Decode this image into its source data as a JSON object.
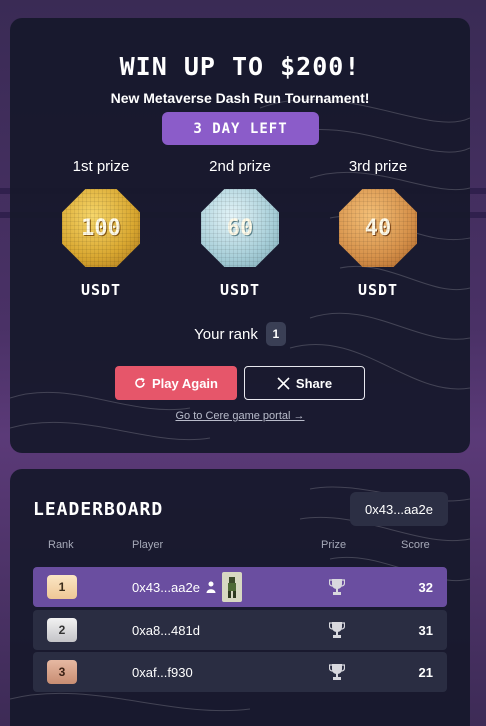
{
  "tournament": {
    "headline": "WIN UP TO $200!",
    "subtitle": "New Metaverse Dash Run Tournament!",
    "days_left": "3 DAY LEFT",
    "prizes": [
      {
        "label": "1st prize",
        "amount": "100",
        "currency": "USDT",
        "tier": "gold"
      },
      {
        "label": "2nd prize",
        "amount": "60",
        "currency": "USDT",
        "tier": "silver"
      },
      {
        "label": "3rd prize",
        "amount": "40",
        "currency": "USDT",
        "tier": "bronze"
      }
    ],
    "rank_label": "Your rank",
    "rank_value": "1",
    "play_again_label": "Play Again",
    "share_label": "Share",
    "portal_link": "Go to Cere game portal →"
  },
  "leaderboard": {
    "title": "LEADERBOARD",
    "wallet": "0x43...aa2e",
    "columns": {
      "rank": "Rank",
      "player": "Player",
      "prize": "Prize",
      "score": "Score"
    },
    "rows": [
      {
        "rank": "1",
        "player": "0x43...aa2e",
        "score": "32",
        "is_me": true
      },
      {
        "rank": "2",
        "player": "0xa8...481d",
        "score": "31",
        "is_me": false
      },
      {
        "rank": "3",
        "player": "0xaf...f930",
        "score": "21",
        "is_me": false
      }
    ]
  },
  "colors": {
    "accent_purple": "#8b5cc9",
    "play_button": "#e6566a",
    "my_row": "#6a4ea0"
  }
}
